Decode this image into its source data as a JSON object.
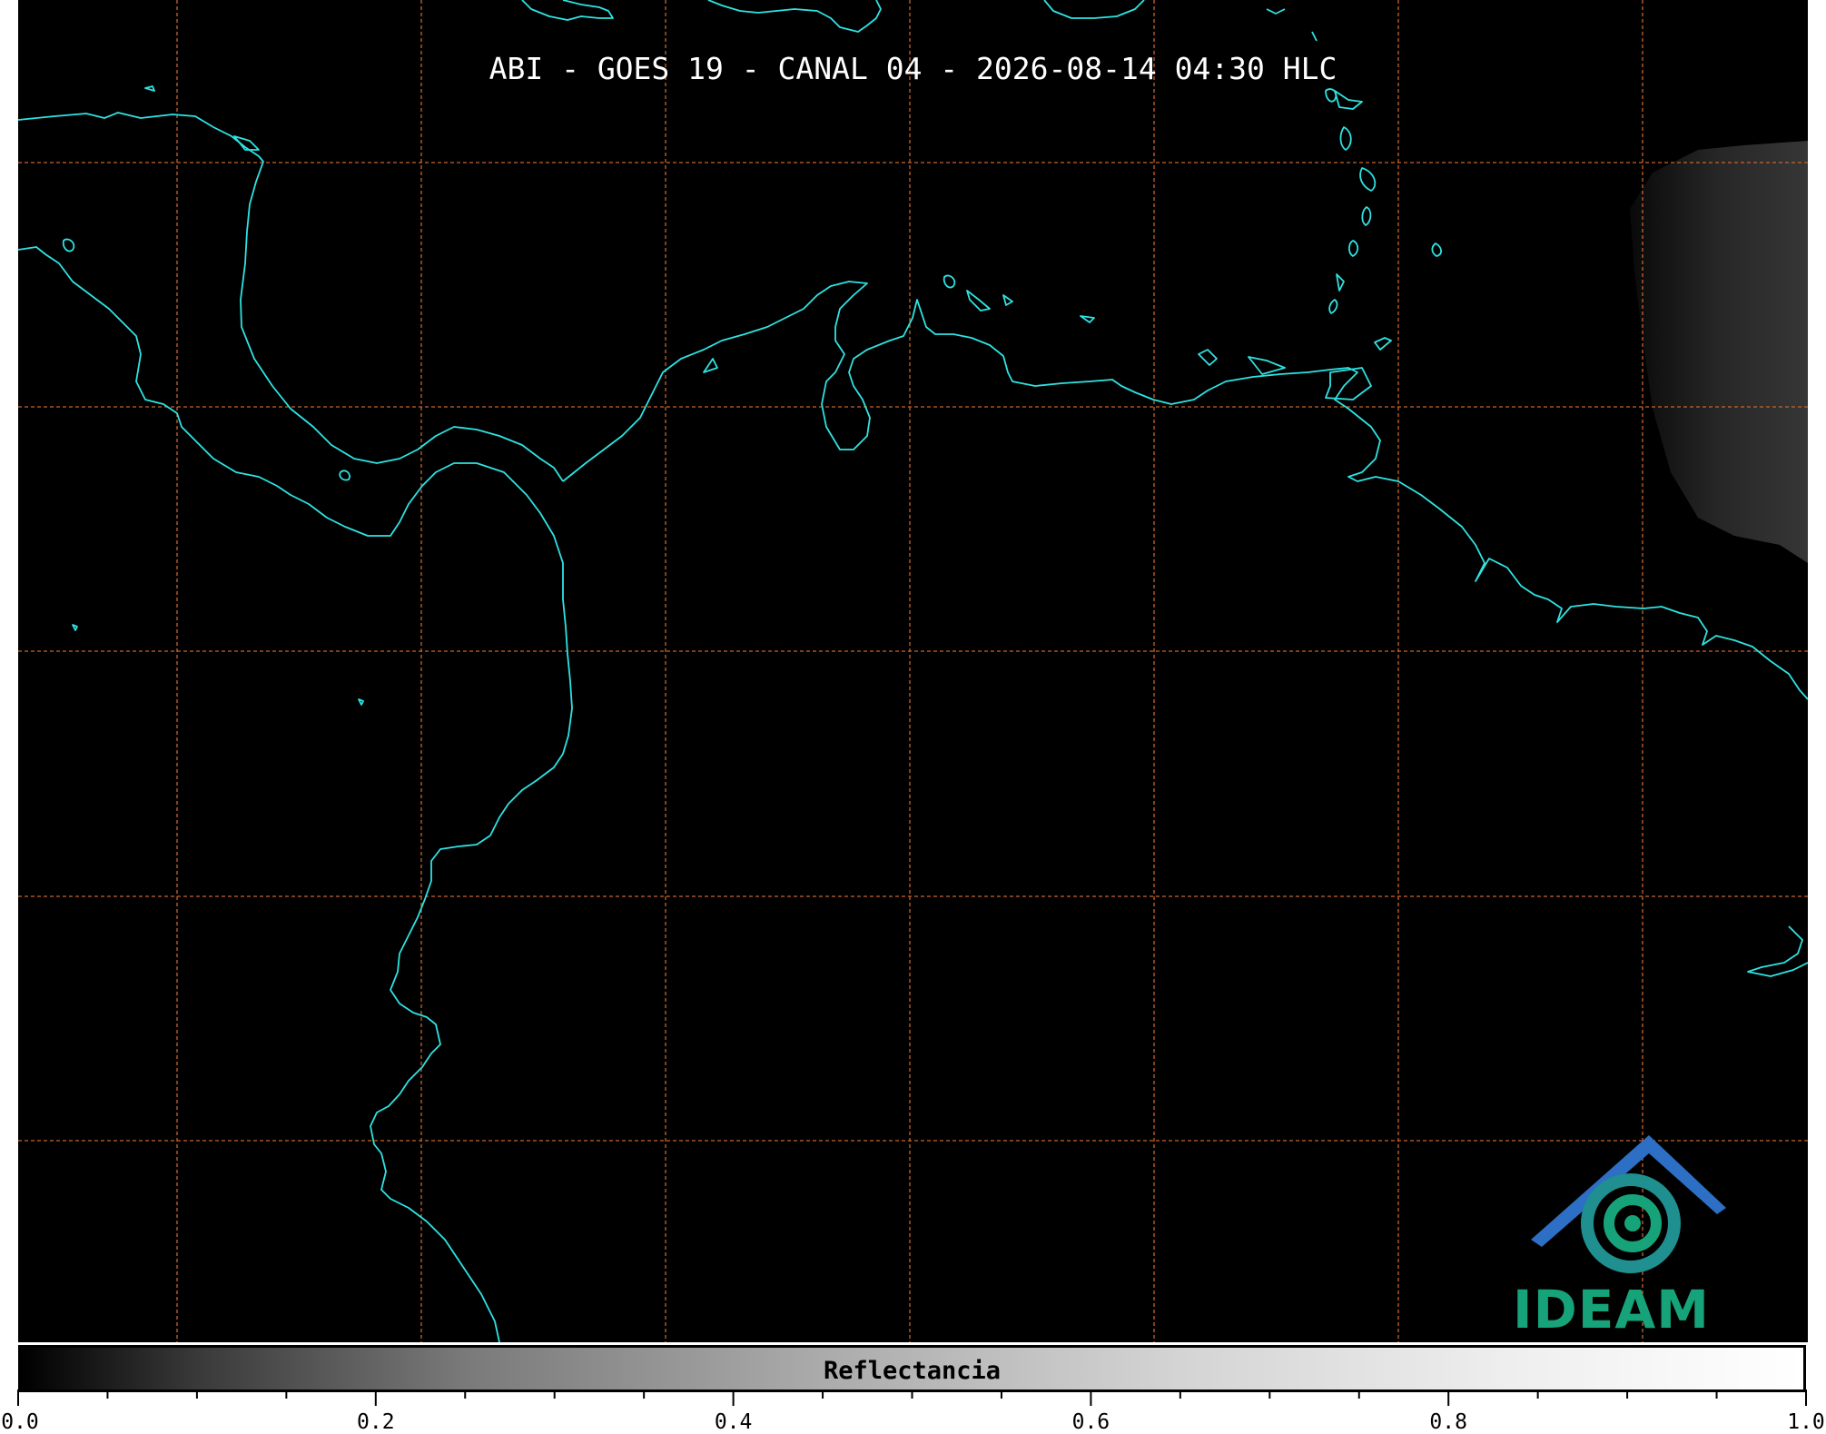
{
  "title": "ABI - GOES 19 - CANAL 04 - 2026-08-14 04:30 HLC",
  "colors": {
    "background": "#000000",
    "coastline": "#2fe3e3",
    "gridlines": "#c8642a",
    "logo_blue": "#2c6fc4",
    "logo_green": "#17a37a"
  },
  "logo": {
    "text": "IDEAM",
    "icon": "ideam-logo-icon"
  },
  "colorbar": {
    "label": "Reflectancia",
    "range": [
      0.0,
      1.0
    ],
    "colormap": "grayscale black-to-white",
    "tick_labels": [
      "0.0",
      "0.2",
      "0.4",
      "0.6",
      "0.8",
      "1.0"
    ]
  }
}
